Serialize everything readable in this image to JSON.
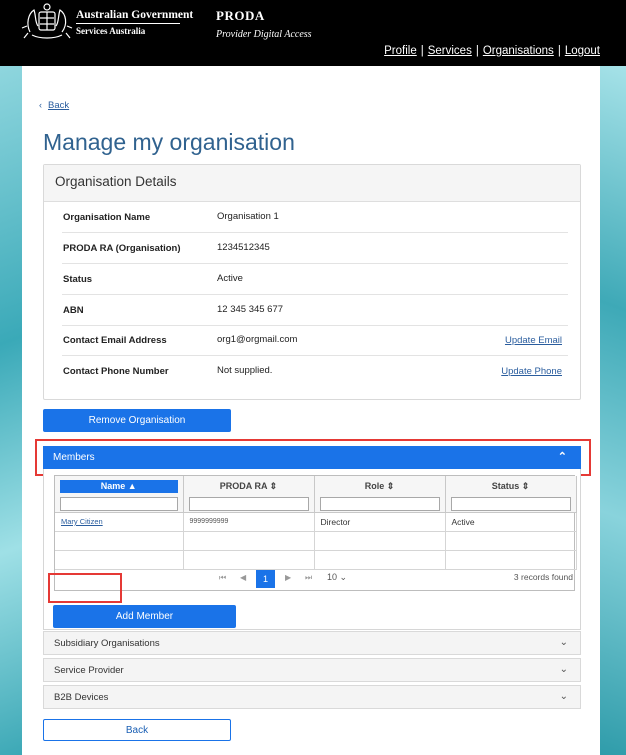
{
  "header": {
    "gov_name": "Australian Government",
    "gov_sub": "Services Australia",
    "app_name": "PRODA",
    "app_sub": "Provider Digital Access",
    "nav": [
      "Profile",
      "Services",
      "Organisations",
      "Logout"
    ],
    "crest_icon": "coat-of-arms-icon"
  },
  "back_link": "Back",
  "page_title": "Manage my organisation",
  "details": {
    "heading": "Organisation Details",
    "rows": [
      {
        "label": "Organisation Name",
        "value": "Organisation 1",
        "action": ""
      },
      {
        "label": "PRODA RA (Organisation)",
        "value": "1234512345",
        "action": ""
      },
      {
        "label": "Status",
        "value": "Active",
        "action": ""
      },
      {
        "label": "ABN",
        "value": "12 345 345 677",
        "action": ""
      },
      {
        "label": "Contact Email Address",
        "value": "org1@orgmail.com",
        "action": "Update Email"
      },
      {
        "label": "Contact Phone Number",
        "value": "Not supplied.",
        "action": "Update Phone"
      }
    ]
  },
  "remove_button": "Remove Organisation",
  "members": {
    "title": "Members",
    "columns": [
      "Name",
      "PRODA RA",
      "Role",
      "Status"
    ],
    "rows": [
      {
        "name": "Mary Citizen",
        "ra": "9999999999",
        "role": "Director",
        "status": "Active"
      },
      {
        "name": "",
        "ra": "",
        "role": "",
        "status": ""
      },
      {
        "name": "",
        "ra": "",
        "role": "",
        "status": ""
      }
    ],
    "pager": {
      "current": "1",
      "page_size": "10",
      "count_text": "3 records found"
    },
    "add_button": "Add Member"
  },
  "sections": [
    "Subsidiary Organisations",
    "Service Provider",
    "B2B Devices"
  ],
  "back_button": "Back",
  "colors": {
    "primary": "#1a73e8",
    "highlight": "#e53935",
    "title": "#30628f"
  }
}
